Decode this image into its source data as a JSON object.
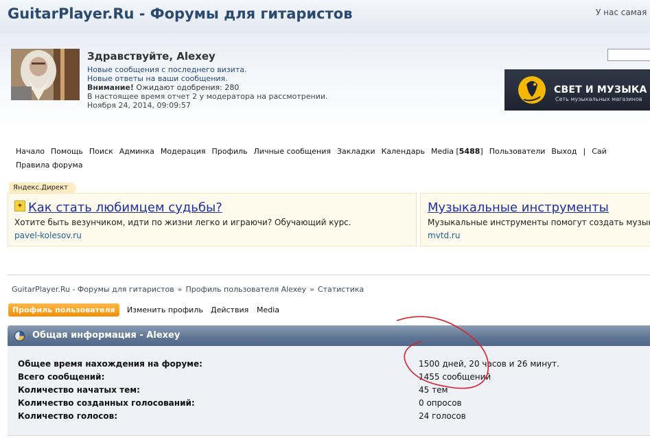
{
  "header": {
    "site_title": "GuitarPlayer.Ru - Форумы для гитаристов",
    "online_text": "У нас самая"
  },
  "user": {
    "greeting": "Здравствуйте, Alexey",
    "new_posts": "Новые сообщения с последнего визита.",
    "new_replies": "Новые ответы на ваши сообщения.",
    "attention_label": "Внимание!",
    "attention_text": " Ожидают одобрения: 280",
    "reports": "В настоящее время отчет 2 у модератора на рассмотрении.",
    "date": "Ноября 24, 2014, 09:09:57"
  },
  "banner": {
    "title": "СВЕТ И МУЗЫКА",
    "subtitle": "Сеть музыкальных магазинов"
  },
  "nav": {
    "items": [
      "Начало",
      "Помощь",
      "Поиск",
      "Админка",
      "Модерация",
      "Профиль",
      "Личные сообщения",
      "Закладки",
      "Календарь"
    ],
    "media_label": "Media [",
    "media_count": "5488",
    "media_close": "]",
    "users": "Пользователи",
    "logout": "Выход",
    "separator": "|",
    "extra": "Сай",
    "rules": "Правила форума"
  },
  "ads": {
    "label": "Яндекс.Директ",
    "ad1": {
      "title": "Как стать любимцем судьбы?",
      "text": "Хотите быть везунчиком, идти по жизни легко и играючи? Обучающий курс.",
      "url": "pavel-kolesov.ru"
    },
    "ad2": {
      "title": "Музыкальные инструменты",
      "text": "Музыкальные инструменты помогут создать музык",
      "url": "mvtd.ru"
    }
  },
  "breadcrumb": {
    "items": [
      "GuitarPlayer.Ru - Форумы для гитаристов",
      "Профиль пользователя Alexey",
      "Статистика"
    ],
    "separator": "»"
  },
  "tabs": {
    "active": "Профиль пользователя",
    "edit": "Изменить профиль",
    "actions": "Действия",
    "media": "Media"
  },
  "stats": {
    "title": "Общая информация - Alexey",
    "rows": [
      {
        "label": "Общее время нахождения на форуме:",
        "value": "1500 дней, 20 часов и 26 минут."
      },
      {
        "label": "Всего сообщений:",
        "value": "1455 сообщений"
      },
      {
        "label": "Количество начатых тем:",
        "value": "45 тем"
      },
      {
        "label": "Количество созданных голосований:",
        "value": "0 опросов"
      },
      {
        "label": "Количество голосов:",
        "value": "24 голосов"
      }
    ]
  },
  "colors": {
    "title": "#2a4a70",
    "annotation": "#d8232a",
    "active_tab": "#f28e00"
  }
}
